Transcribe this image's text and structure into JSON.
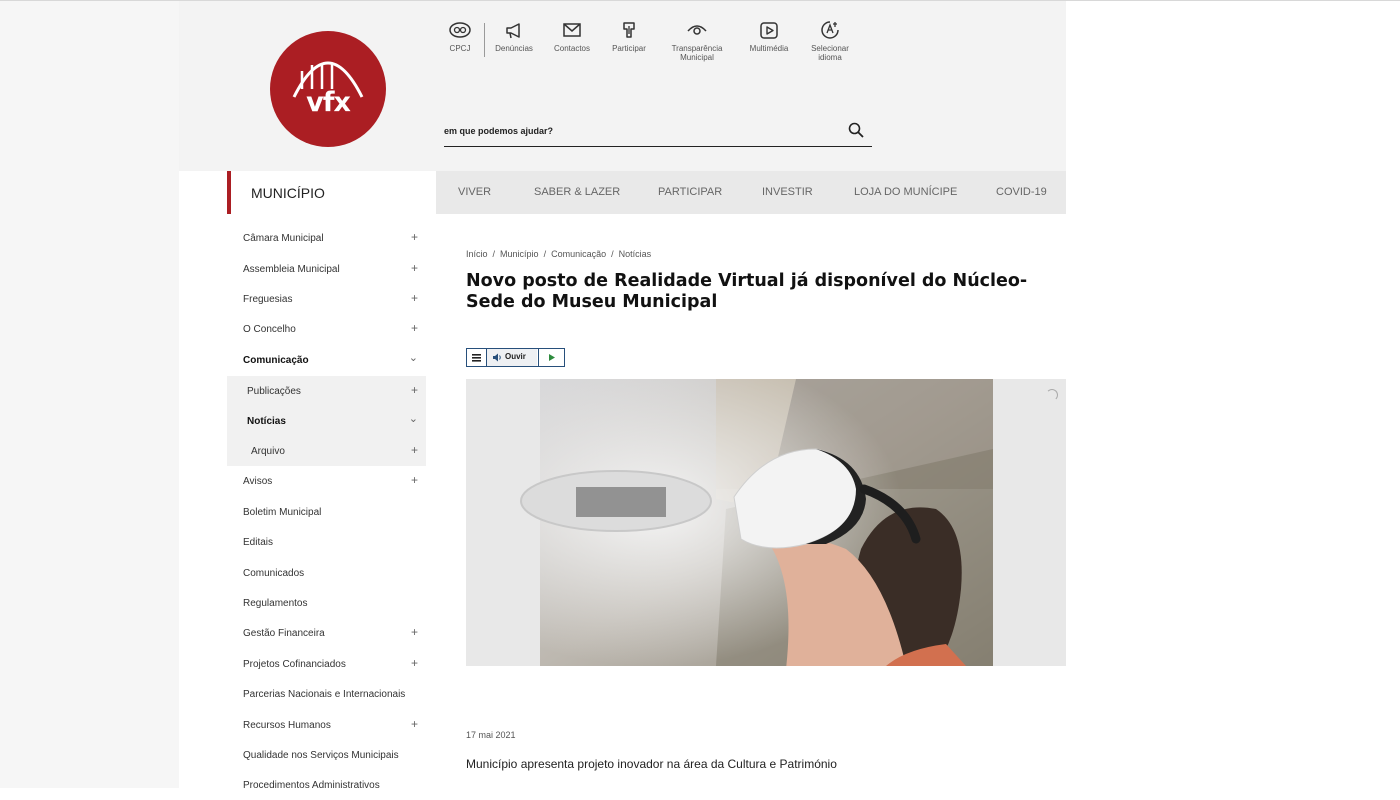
{
  "logo": {
    "text": "vfx"
  },
  "utility_nav": [
    {
      "label": "CPCJ",
      "icon": "cpcj-icon"
    },
    {
      "label": "Denúncias",
      "icon": "megaphone-icon"
    },
    {
      "label": "Contactos",
      "icon": "envelope-icon"
    },
    {
      "label": "Participar",
      "icon": "participate-icon"
    },
    {
      "label": "Transparência Municipal",
      "icon": "eye-icon"
    },
    {
      "label": "Multimédia",
      "icon": "video-icon"
    },
    {
      "label": "Selecionar idioma",
      "icon": "language-icon"
    }
  ],
  "search": {
    "placeholder": "em que podemos ajudar?"
  },
  "section_title": "MUNICÍPIO",
  "main_nav": [
    "VIVER",
    "SABER & LAZER",
    "PARTICIPAR",
    "INVESTIR",
    "LOJA DO MUNÍCIPE",
    "COVID-19"
  ],
  "sidebar": [
    {
      "label": "Câmara Municipal",
      "toggle": "+"
    },
    {
      "label": "Assembleia Municipal",
      "toggle": "+"
    },
    {
      "label": "Freguesias",
      "toggle": "+"
    },
    {
      "label": "O Concelho",
      "toggle": "+"
    },
    {
      "label": "Comunicação",
      "toggle": "⌄"
    },
    {
      "label": "Publicações",
      "toggle": "+"
    },
    {
      "label": "Notícias",
      "toggle": "⌄"
    },
    {
      "label": "Arquivo",
      "toggle": "+"
    },
    {
      "label": "Avisos",
      "toggle": "+"
    },
    {
      "label": "Boletim Municipal",
      "toggle": ""
    },
    {
      "label": "Editais",
      "toggle": ""
    },
    {
      "label": "Comunicados",
      "toggle": ""
    },
    {
      "label": "Regulamentos",
      "toggle": ""
    },
    {
      "label": "Gestão Financeira",
      "toggle": "+"
    },
    {
      "label": "Projetos Cofinanciados",
      "toggle": "+"
    },
    {
      "label": "Parcerias Nacionais e Internacionais",
      "toggle": ""
    },
    {
      "label": "Recursos Humanos",
      "toggle": "+"
    },
    {
      "label": "Qualidade nos Serviços Municipais",
      "toggle": ""
    },
    {
      "label": "Procedimentos Administrativos",
      "toggle": ""
    }
  ],
  "breadcrumb": [
    "Início",
    "/",
    "Município",
    "/",
    "Comunicação",
    "/",
    "Notícias"
  ],
  "article": {
    "title": "Novo posto de Realidade Virtual já disponível do Núcleo-Sede do Museu Municipal",
    "listen_label": "Ouvir",
    "date": "17 mai 2021",
    "lead": "Município apresenta projeto inovador na área da Cultura e Património"
  },
  "colors": {
    "brand": "#ab1e23",
    "player_border": "#274f7b",
    "play": "#2e8b3e"
  }
}
